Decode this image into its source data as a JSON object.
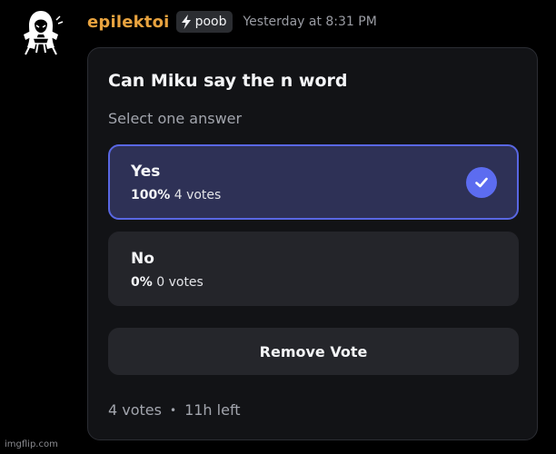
{
  "message": {
    "username": "epilektoi",
    "tag": {
      "icon": "lightning-icon",
      "label": "poob"
    },
    "timestamp": "Yesterday at 8:31 PM",
    "avatar_icon": "avatar-icon"
  },
  "poll": {
    "question": "Can Miku say the n word",
    "subtitle": "Select one answer",
    "options": [
      {
        "label": "Yes",
        "percent": "100%",
        "votes": "4 votes",
        "selected": true,
        "check_icon": "check-icon"
      },
      {
        "label": "No",
        "percent": "0%",
        "votes": "0 votes",
        "selected": false
      }
    ],
    "remove_vote_label": "Remove Vote",
    "footer": {
      "total_votes": "4 votes",
      "separator": "•",
      "time_left": "11h left"
    }
  },
  "watermark": "imgflip.com",
  "colors": {
    "username": "#e8a33f",
    "selected_border": "#5967e3",
    "selected_bg": "#2e3156",
    "check_bg": "#5c6cf0",
    "card_bg": "#121316"
  }
}
